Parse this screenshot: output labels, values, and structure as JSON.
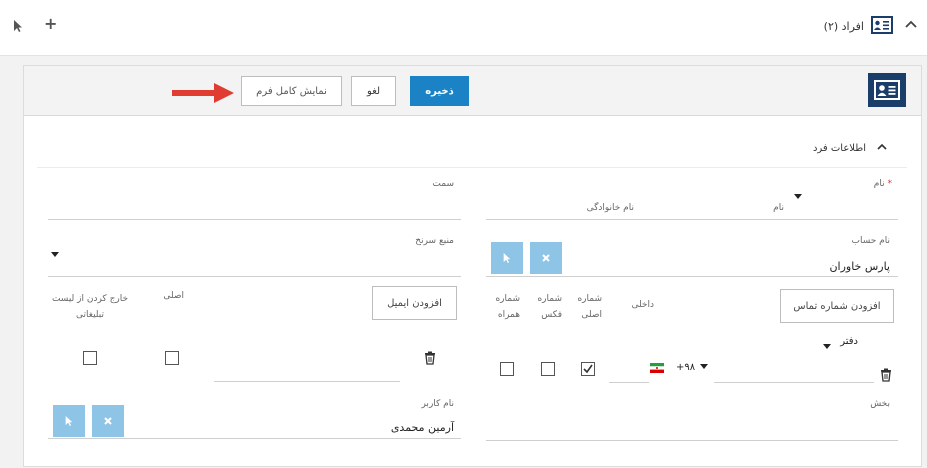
{
  "topbar": {
    "title": "افراد (۲)",
    "plus": "+",
    "icons": [
      "cursor-icon",
      "plus-icon",
      "chevron-up-icon",
      "contact-card-icon"
    ]
  },
  "toolbar": {
    "save_label": "ذخیره",
    "cancel_label": "لغو",
    "full_form_label": "نمایش کامل فرم"
  },
  "section": {
    "title": "اطلاعات فرد"
  },
  "form": {
    "name_label": "نام",
    "name_required": "*",
    "first_name_placeholder": "نام",
    "last_name_placeholder": "نام خانوادگی",
    "position_label": "سمت",
    "account_label": "نام حساب",
    "account_value": "پارس خاوران",
    "lead_source_label": "منبع سرنخ",
    "add_phone_label": "افزودن شماره تماس",
    "add_email_label": "افزودن ایمیل",
    "phone_cols": {
      "internal": "داخلی",
      "main": "شماره اصلی",
      "fax": "شماره فکس",
      "mobile": "شماره همراه"
    },
    "email_cols": {
      "main": "اصلی",
      "unsubscribe": "خارج کردن از لیست تبلیغاتی"
    },
    "phone_type": "دفتر",
    "country_code": "+۹۸",
    "department_label": "بخش",
    "user_label": "نام کاربر",
    "user_value": "آرمین محمدی",
    "checkbox_states": {
      "phone_main": true,
      "phone_fax": false,
      "phone_mobile": false,
      "email_main": false,
      "email_unsubscribe": false
    }
  },
  "colors": {
    "primary": "#1b82c6",
    "header_icon_bg": "#1b3d6a",
    "square_button": "#8ec4e6",
    "arrow": "#e03c31"
  }
}
